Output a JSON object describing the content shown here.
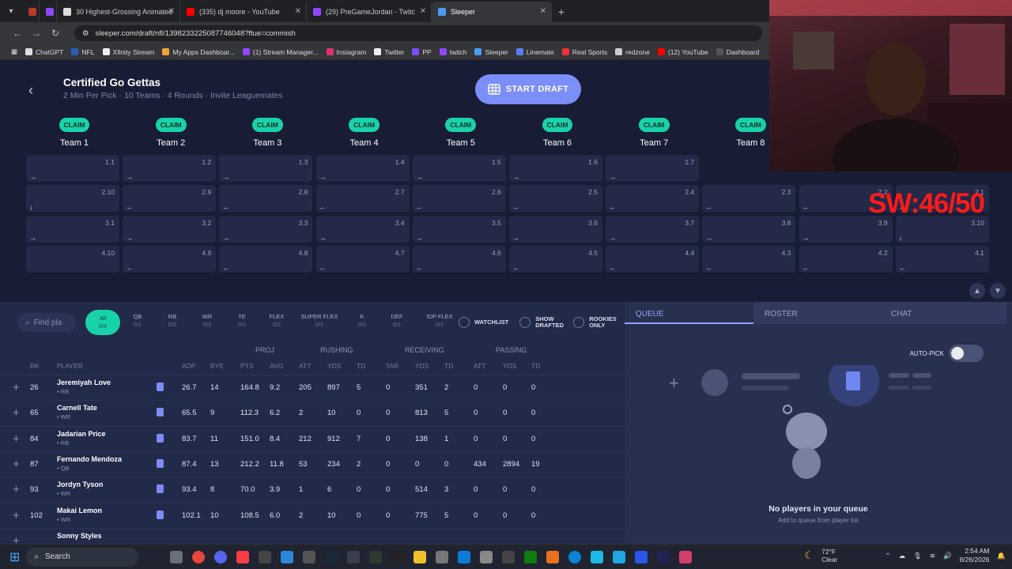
{
  "browser": {
    "tabs": [
      {
        "title": "30 Highest-Grossing Animated",
        "color": "#4a8cf7"
      },
      {
        "title": "(335) dj moore - YouTube",
        "color": "#ff0000"
      },
      {
        "title": "(29) PreGameJordan - Twitc",
        "color": "#9146ff"
      },
      {
        "title": "Sleeper",
        "color": "#4b9cf5"
      }
    ],
    "url": "sleeper.com/draft/nfl/1398233225087746048?ftue=commish",
    "bookmarks": [
      {
        "label": "ChatGPT",
        "color": "#ddd"
      },
      {
        "label": "NFL",
        "color": "#2a5cb8"
      },
      {
        "label": "Xfinity Stream",
        "color": "#eee"
      },
      {
        "label": "My Apps Dashboar...",
        "color": "#f2a33a"
      },
      {
        "label": "(1) Stream Manager...",
        "color": "#9146ff"
      },
      {
        "label": "Instagram",
        "color": "#e1306c"
      },
      {
        "label": "Twitter",
        "color": "#eee"
      },
      {
        "label": "PP",
        "color": "#7c4dff"
      },
      {
        "label": "twitch",
        "color": "#9146ff"
      },
      {
        "label": "Sleeper",
        "color": "#4b9cf5"
      },
      {
        "label": "Linemate",
        "color": "#5b7cff"
      },
      {
        "label": "Real Sports",
        "color": "#e33"
      },
      {
        "label": "redzone",
        "color": "#ccc"
      },
      {
        "label": "(12) YouTube",
        "color": "#ff0000"
      },
      {
        "label": "Dashboard",
        "color": "#555"
      }
    ]
  },
  "league": {
    "name": "Certified Go Gettas",
    "subtitle": "2 Min Per Pick · 10 Teams · 4 Rounds · Invite Leaguemates",
    "start_label": "START DRAFT"
  },
  "teams": [
    {
      "claim": "CLAIM",
      "name": "Team 1"
    },
    {
      "claim": "CLAIM",
      "name": "Team 2"
    },
    {
      "claim": "CLAIM",
      "name": "Team 3"
    },
    {
      "claim": "CLAIM",
      "name": "Team 4"
    },
    {
      "claim": "CLAIM",
      "name": "Team 5"
    },
    {
      "claim": "CLAIM",
      "name": "Team 6"
    },
    {
      "claim": "CLAIM",
      "name": "Team 7"
    },
    {
      "claim": "CLAIM",
      "name": "Team 8"
    }
  ],
  "board": [
    [
      "1.1",
      "1.2",
      "1.3",
      "1.4",
      "1.5",
      "1.6",
      "1.7",
      "",
      "",
      ""
    ],
    [
      "2.10",
      "2.9",
      "2.8",
      "2.7",
      "2.6",
      "2.5",
      "2.4",
      "2.3",
      "2.2",
      "2.1"
    ],
    [
      "3.1",
      "3.2",
      "3.3",
      "3.4",
      "3.5",
      "3.6",
      "3.7",
      "3.8",
      "3.9",
      "3.10"
    ],
    [
      "4.10",
      "4.9",
      "4.8",
      "4.7",
      "4.6",
      "4.5",
      "4.4",
      "4.3",
      "4.2",
      "4.1"
    ]
  ],
  "filters": {
    "search_placeholder": "Find pla",
    "positions": [
      {
        "label": "All",
        "count": "0/4"
      },
      {
        "label": "QB",
        "count": "0/1"
      },
      {
        "label": "RB",
        "count": "0/2"
      },
      {
        "label": "WR",
        "count": "0/2"
      },
      {
        "label": "TE",
        "count": "0/1"
      },
      {
        "label": "FLEX",
        "count": "0/2"
      },
      {
        "label": "SUPER FLEX",
        "count": "0/1"
      },
      {
        "label": "K",
        "count": "0/1"
      },
      {
        "label": "DEF",
        "count": "0/1"
      },
      {
        "label": "IDP FLEX",
        "count": "0/1"
      }
    ],
    "watchlist": "WATCHLIST",
    "show_drafted": "SHOW DRAFTED",
    "rookies_only": "ROOKIES ONLY"
  },
  "table": {
    "groups": {
      "proj": "PROJ",
      "rushing": "RUSHING",
      "receiving": "RECEIVING",
      "passing": "PASSING"
    },
    "columns": {
      "rk": "RK",
      "player": "PLAYER",
      "adp": "ADP",
      "bye": "BYE",
      "pts": "PTS",
      "avg": "AVG",
      "ru_att": "ATT",
      "ru_yds": "YDS",
      "ru_td": "TD",
      "re_tar": "TAR",
      "re_yds": "YDS",
      "re_td": "TD",
      "pa_att": "ATT",
      "pa_yds": "YDS",
      "pa_td": "TD"
    },
    "rows": [
      {
        "rk": "26",
        "name": "Jeremiyah Love",
        "meta": "• RB",
        "adp": "26.7",
        "bye": "14",
        "pts": "164.8",
        "avg": "9.2",
        "ru_att": "205",
        "ru_yds": "897",
        "ru_td": "5",
        "re_tar": "0",
        "re_yds": "351",
        "re_td": "2",
        "pa_att": "0",
        "pa_yds": "0",
        "pa_td": "0"
      },
      {
        "rk": "65",
        "name": "Carnell Tate",
        "meta": "• WR",
        "adp": "65.5",
        "bye": "9",
        "pts": "112.3",
        "avg": "6.2",
        "ru_att": "2",
        "ru_yds": "10",
        "ru_td": "0",
        "re_tar": "0",
        "re_yds": "813",
        "re_td": "5",
        "pa_att": "0",
        "pa_yds": "0",
        "pa_td": "0"
      },
      {
        "rk": "84",
        "name": "Jadarian Price",
        "meta": "• RB",
        "adp": "83.7",
        "bye": "11",
        "pts": "151.0",
        "avg": "8.4",
        "ru_att": "212",
        "ru_yds": "912",
        "ru_td": "7",
        "re_tar": "0",
        "re_yds": "138",
        "re_td": "1",
        "pa_att": "0",
        "pa_yds": "0",
        "pa_td": "0"
      },
      {
        "rk": "87",
        "name": "Fernando Mendoza",
        "meta": "• QB",
        "adp": "87.4",
        "bye": "13",
        "pts": "212.2",
        "avg": "11.8",
        "ru_att": "53",
        "ru_yds": "234",
        "ru_td": "2",
        "re_tar": "0",
        "re_yds": "0",
        "re_td": "0",
        "pa_att": "434",
        "pa_yds": "2894",
        "pa_td": "19"
      },
      {
        "rk": "93",
        "name": "Jordyn Tyson",
        "meta": "• WR",
        "adp": "93.4",
        "bye": "8",
        "pts": "70.0",
        "avg": "3.9",
        "ru_att": "1",
        "ru_yds": "6",
        "ru_td": "0",
        "re_tar": "0",
        "re_yds": "514",
        "re_td": "3",
        "pa_att": "0",
        "pa_yds": "0",
        "pa_td": "0"
      },
      {
        "rk": "102",
        "name": "Makai Lemon",
        "meta": "• WR",
        "adp": "102.1",
        "bye": "10",
        "pts": "108.5",
        "avg": "6.0",
        "ru_att": "2",
        "ru_yds": "10",
        "ru_td": "0",
        "re_tar": "0",
        "re_yds": "775",
        "re_td": "5",
        "pa_att": "0",
        "pa_yds": "0",
        "pa_td": "0"
      },
      {
        "rk": "",
        "name": "Sonny Styles",
        "meta": "",
        "adp": "",
        "bye": "",
        "pts": "",
        "avg": "",
        "ru_att": "",
        "ru_yds": "",
        "ru_td": "",
        "re_tar": "",
        "re_yds": "",
        "re_td": "",
        "pa_att": "",
        "pa_yds": "",
        "pa_td": ""
      }
    ]
  },
  "queue_panel": {
    "tabs": {
      "queue": "QUEUE",
      "roster": "ROSTER",
      "chat": "CHAT"
    },
    "autopick": "AUTO-PICK",
    "empty_title": "No players in your queue",
    "empty_sub": "Add to queue from player list"
  },
  "overlay": {
    "sw_text": "SW:46/50"
  },
  "taskbar": {
    "search": "Search",
    "temp": "72°F",
    "weather": "Clear",
    "time": "2:54 AM",
    "date": "8/26/2026"
  }
}
